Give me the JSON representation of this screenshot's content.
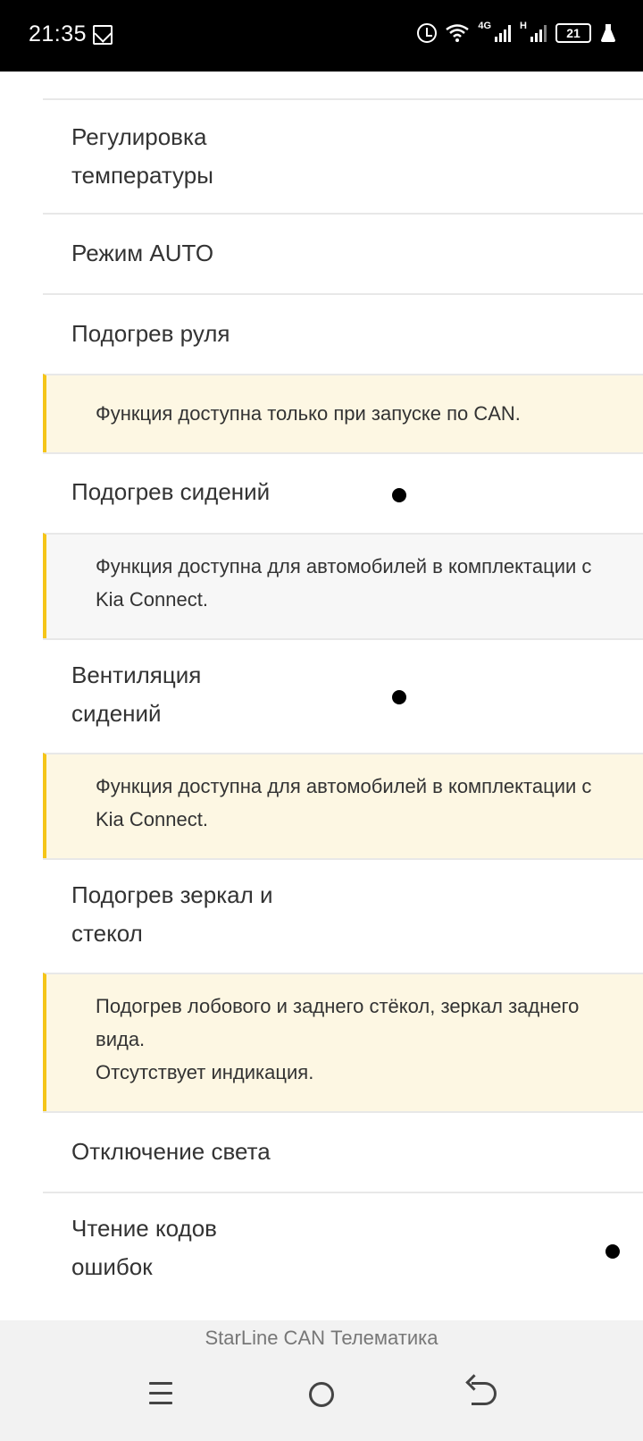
{
  "status_bar": {
    "time": "21:35",
    "network_4g": "4G",
    "network_h": "H",
    "battery": "21"
  },
  "rows": [
    {
      "label": "Регулировка\nтемпературы"
    },
    {
      "label": "Режим AUTO"
    },
    {
      "label": "Подогрев руля"
    },
    {
      "note": "Функция доступна только при запуске по CAN."
    },
    {
      "label": "Подогрев сидений"
    },
    {
      "note": "Функция доступна для автомобилей в комплектации с\nKia Connect."
    },
    {
      "label": "Вентиляция\nсидений"
    },
    {
      "note": "Функция доступна для автомобилей в комплектации с\nKia Connect."
    },
    {
      "label": "Подогрев зеркал и\nстекол"
    },
    {
      "note": "Подогрев лобового и заднего стёкол, зеркал заднего\nвида.\nОтсутствует индикация."
    },
    {
      "label": "Отключение света"
    },
    {
      "label": "Чтение кодов\nошибок"
    }
  ],
  "app_title": "StarLine CAN Телематика"
}
